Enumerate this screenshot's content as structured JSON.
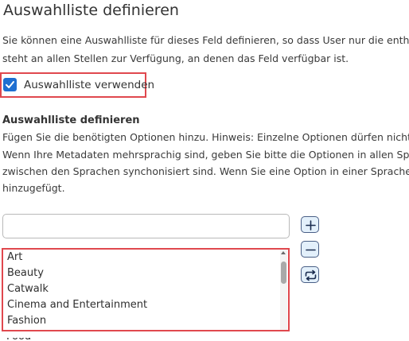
{
  "page": {
    "title": "Auswahlliste definieren",
    "intro_lines": [
      "Sie können eine Auswahlliste für dieses Feld definieren, so dass User nur die enthalt",
      "steht an allen Stellen zur Verfügung, an denen das Feld verfügbar ist."
    ]
  },
  "use_list": {
    "label": "Auswahlliste verwenden",
    "checked": true
  },
  "define_section": {
    "heading": "Auswahlliste definieren",
    "hint_lines": [
      "Fügen Sie die benötigten Optionen hinzu. Hinweis: Einzelne Optionen dürfen nicht",
      "Wenn Ihre Metadaten mehrsprachig sind, geben Sie bitte die Optionen in allen Spr",
      "zwischen den Sprachen synchonisiert sind. Wenn Sie eine Option in einer Sprache",
      "hinzugefügt."
    ]
  },
  "new_option": {
    "value": "",
    "placeholder": ""
  },
  "options_list": {
    "items": [
      "Art",
      "Beauty",
      "Catwalk",
      "Cinema and Entertainment",
      "Fashion"
    ],
    "partially_visible_item": "Food"
  },
  "buttons": [
    {
      "name": "add-option-button",
      "icon": "plus-icon"
    },
    {
      "name": "remove-option-button",
      "icon": "minus-icon"
    },
    {
      "name": "sync-options-button",
      "icon": "repeat-icon"
    }
  ],
  "colors": {
    "checkbox_checked": "#1f6fd1",
    "highlight_border": "#e0484e",
    "icon_button_bg": "#e3f0fb",
    "icon_button_border": "#4a5f86"
  }
}
